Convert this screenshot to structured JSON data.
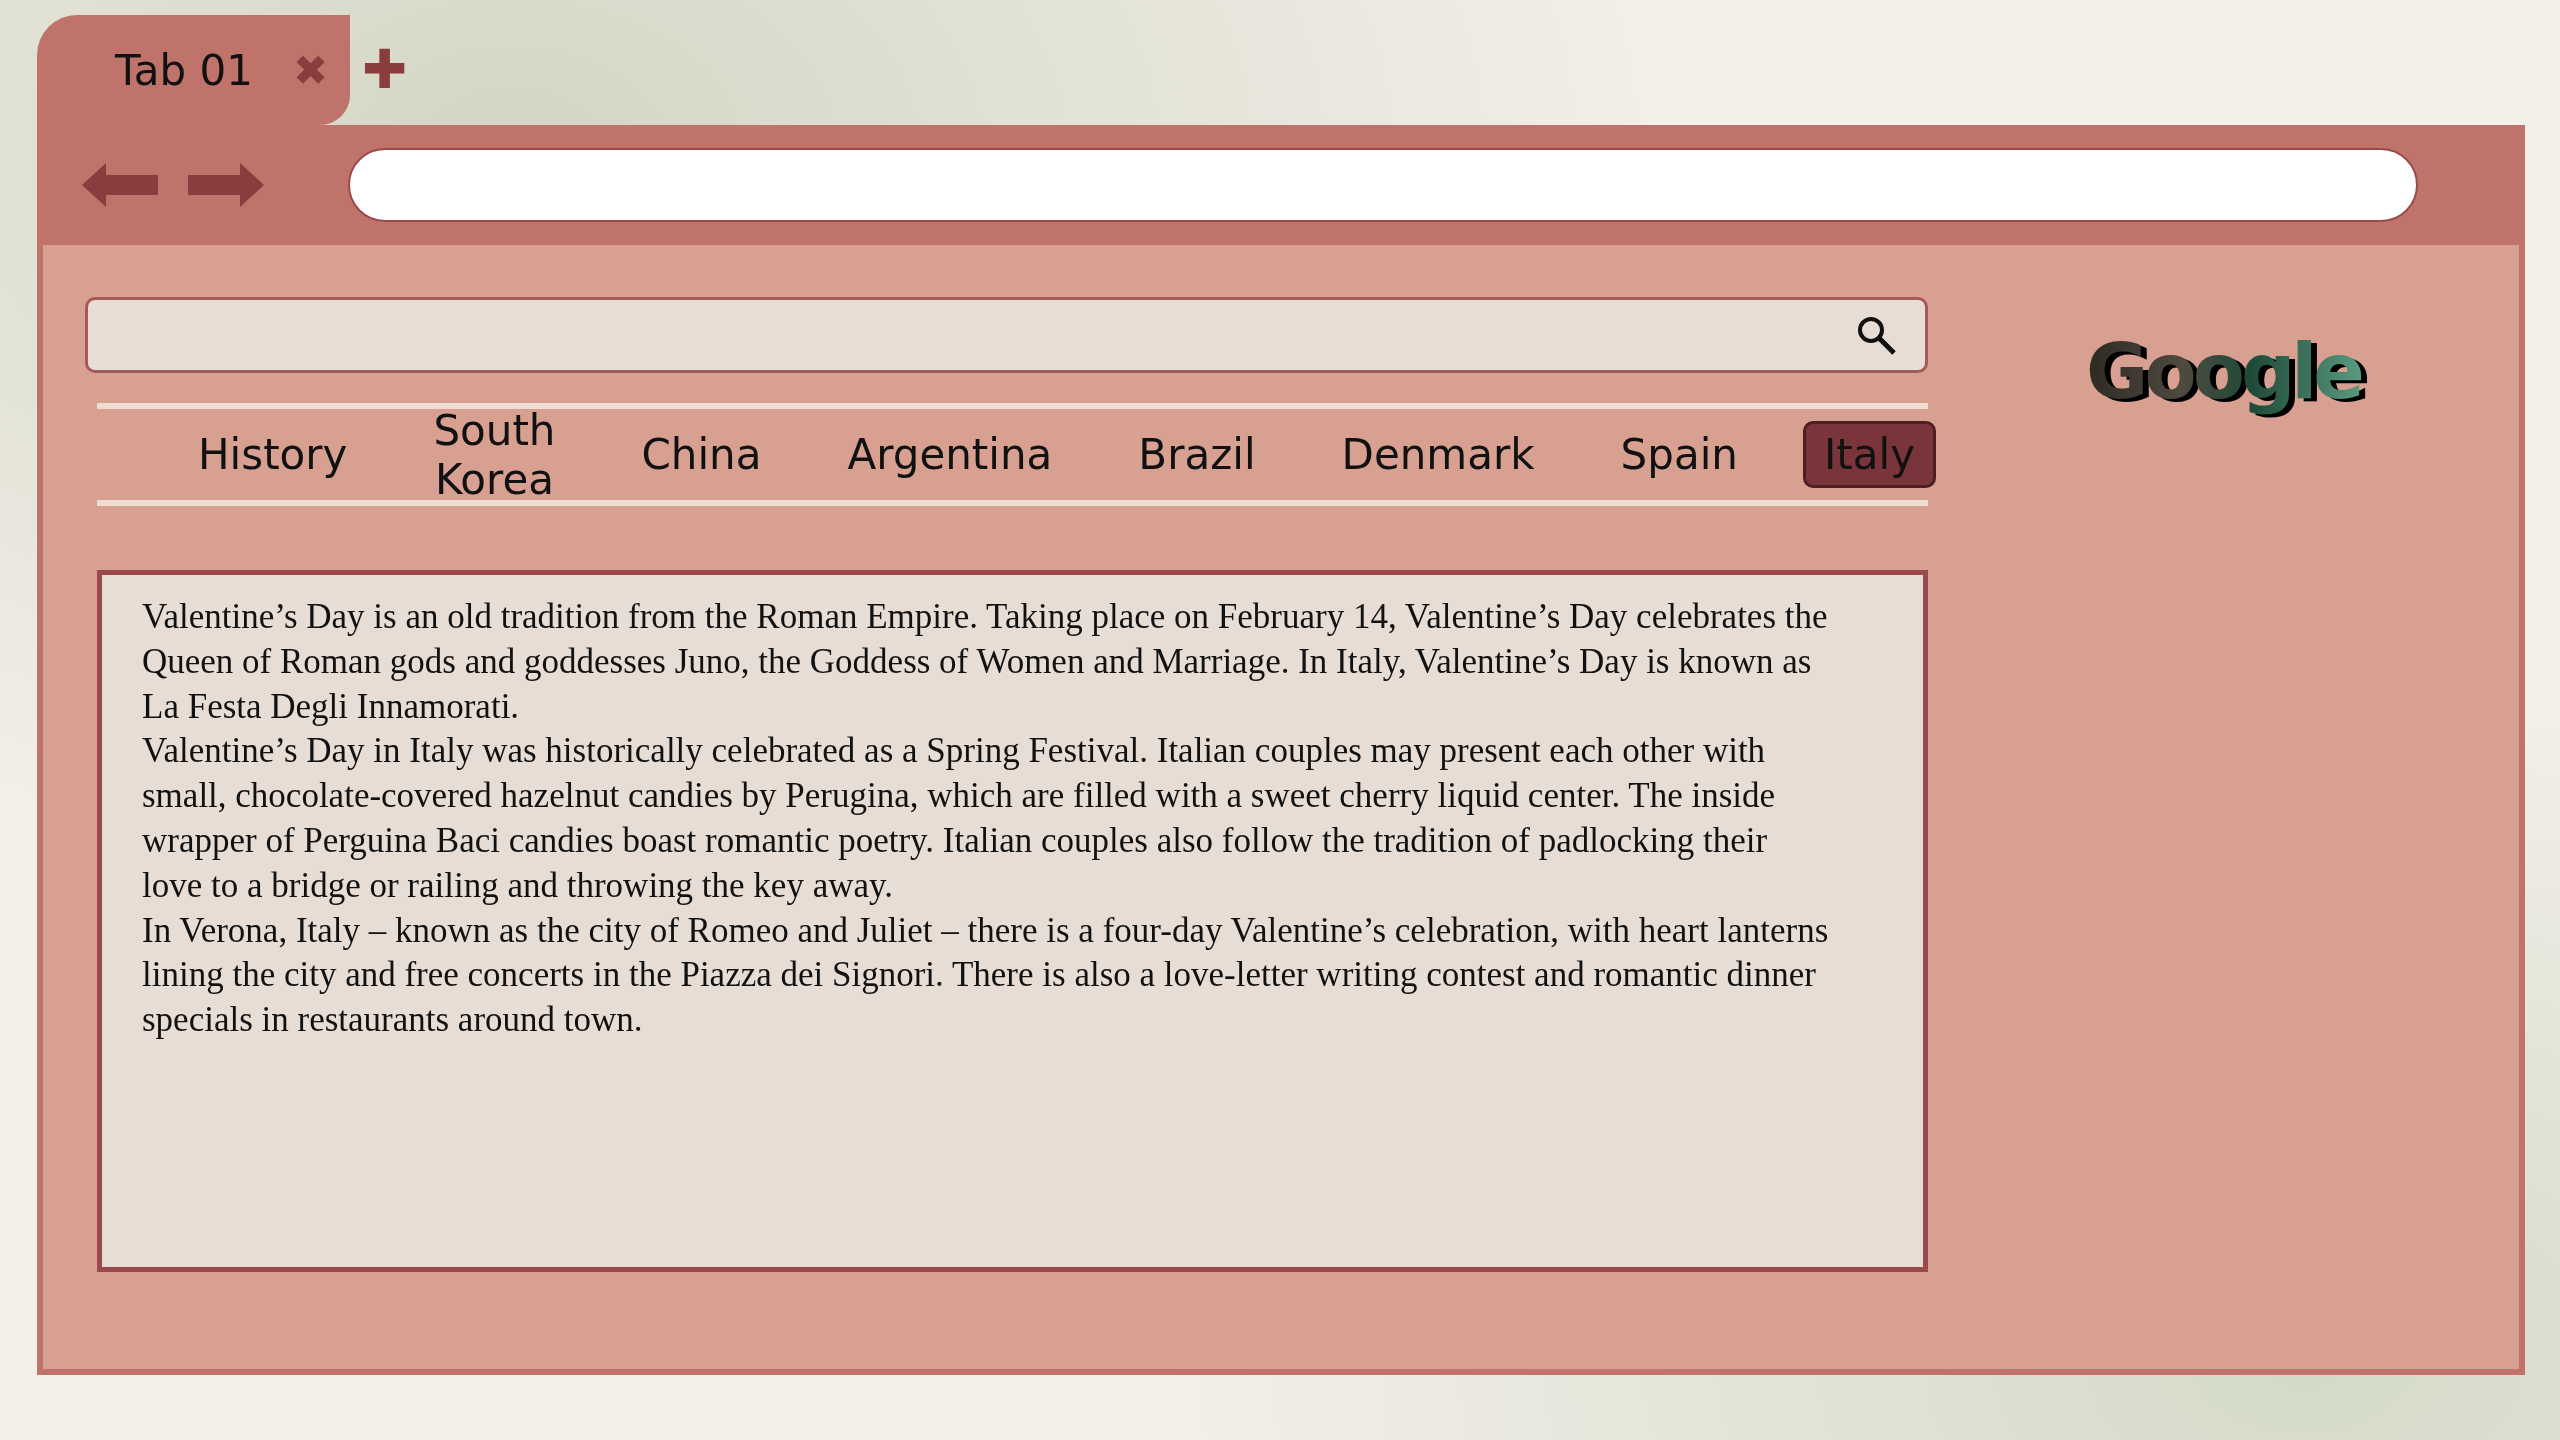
{
  "tab": {
    "title": "Tab 01",
    "close_glyph": "✖",
    "new_tab_glyph": "✚"
  },
  "logo": "Google",
  "nav": [
    {
      "label": "History",
      "selected": false
    },
    {
      "label": "South Korea",
      "selected": false
    },
    {
      "label": "China",
      "selected": false
    },
    {
      "label": "Argentina",
      "selected": false
    },
    {
      "label": "Brazil",
      "selected": false
    },
    {
      "label": "Denmark",
      "selected": false
    },
    {
      "label": "Spain",
      "selected": false
    },
    {
      "label": "Italy",
      "selected": true
    }
  ],
  "article": [
    "Valentine’s Day is an old tradition from the Roman Empire. Taking place on February 14, Valentine’s Day celebrates the Queen of Roman gods and goddesses Juno, the Goddess of Women and Marriage. In Italy, Valentine’s Day is known as La Festa Degli Innamorati.",
    "Valentine’s Day in Italy was historically celebrated as a Spring Festival. Italian couples may present each other with small, chocolate-covered hazelnut candies by Perugina, which are filled with a sweet cherry liquid center. The inside wrapper of Perguina Baci candies boast romantic poetry. Italian couples also follow the tradition of padlocking their love to a bridge or railing and throwing the key away.",
    "In Verona, Italy – known as the city of Romeo and Juliet – there is a four-day Valentine’s celebration, with heart lanterns lining the city and free concerts in the Piazza dei Signori. There is also a love-letter writing contest and romantic dinner specials in restaurants around town."
  ]
}
